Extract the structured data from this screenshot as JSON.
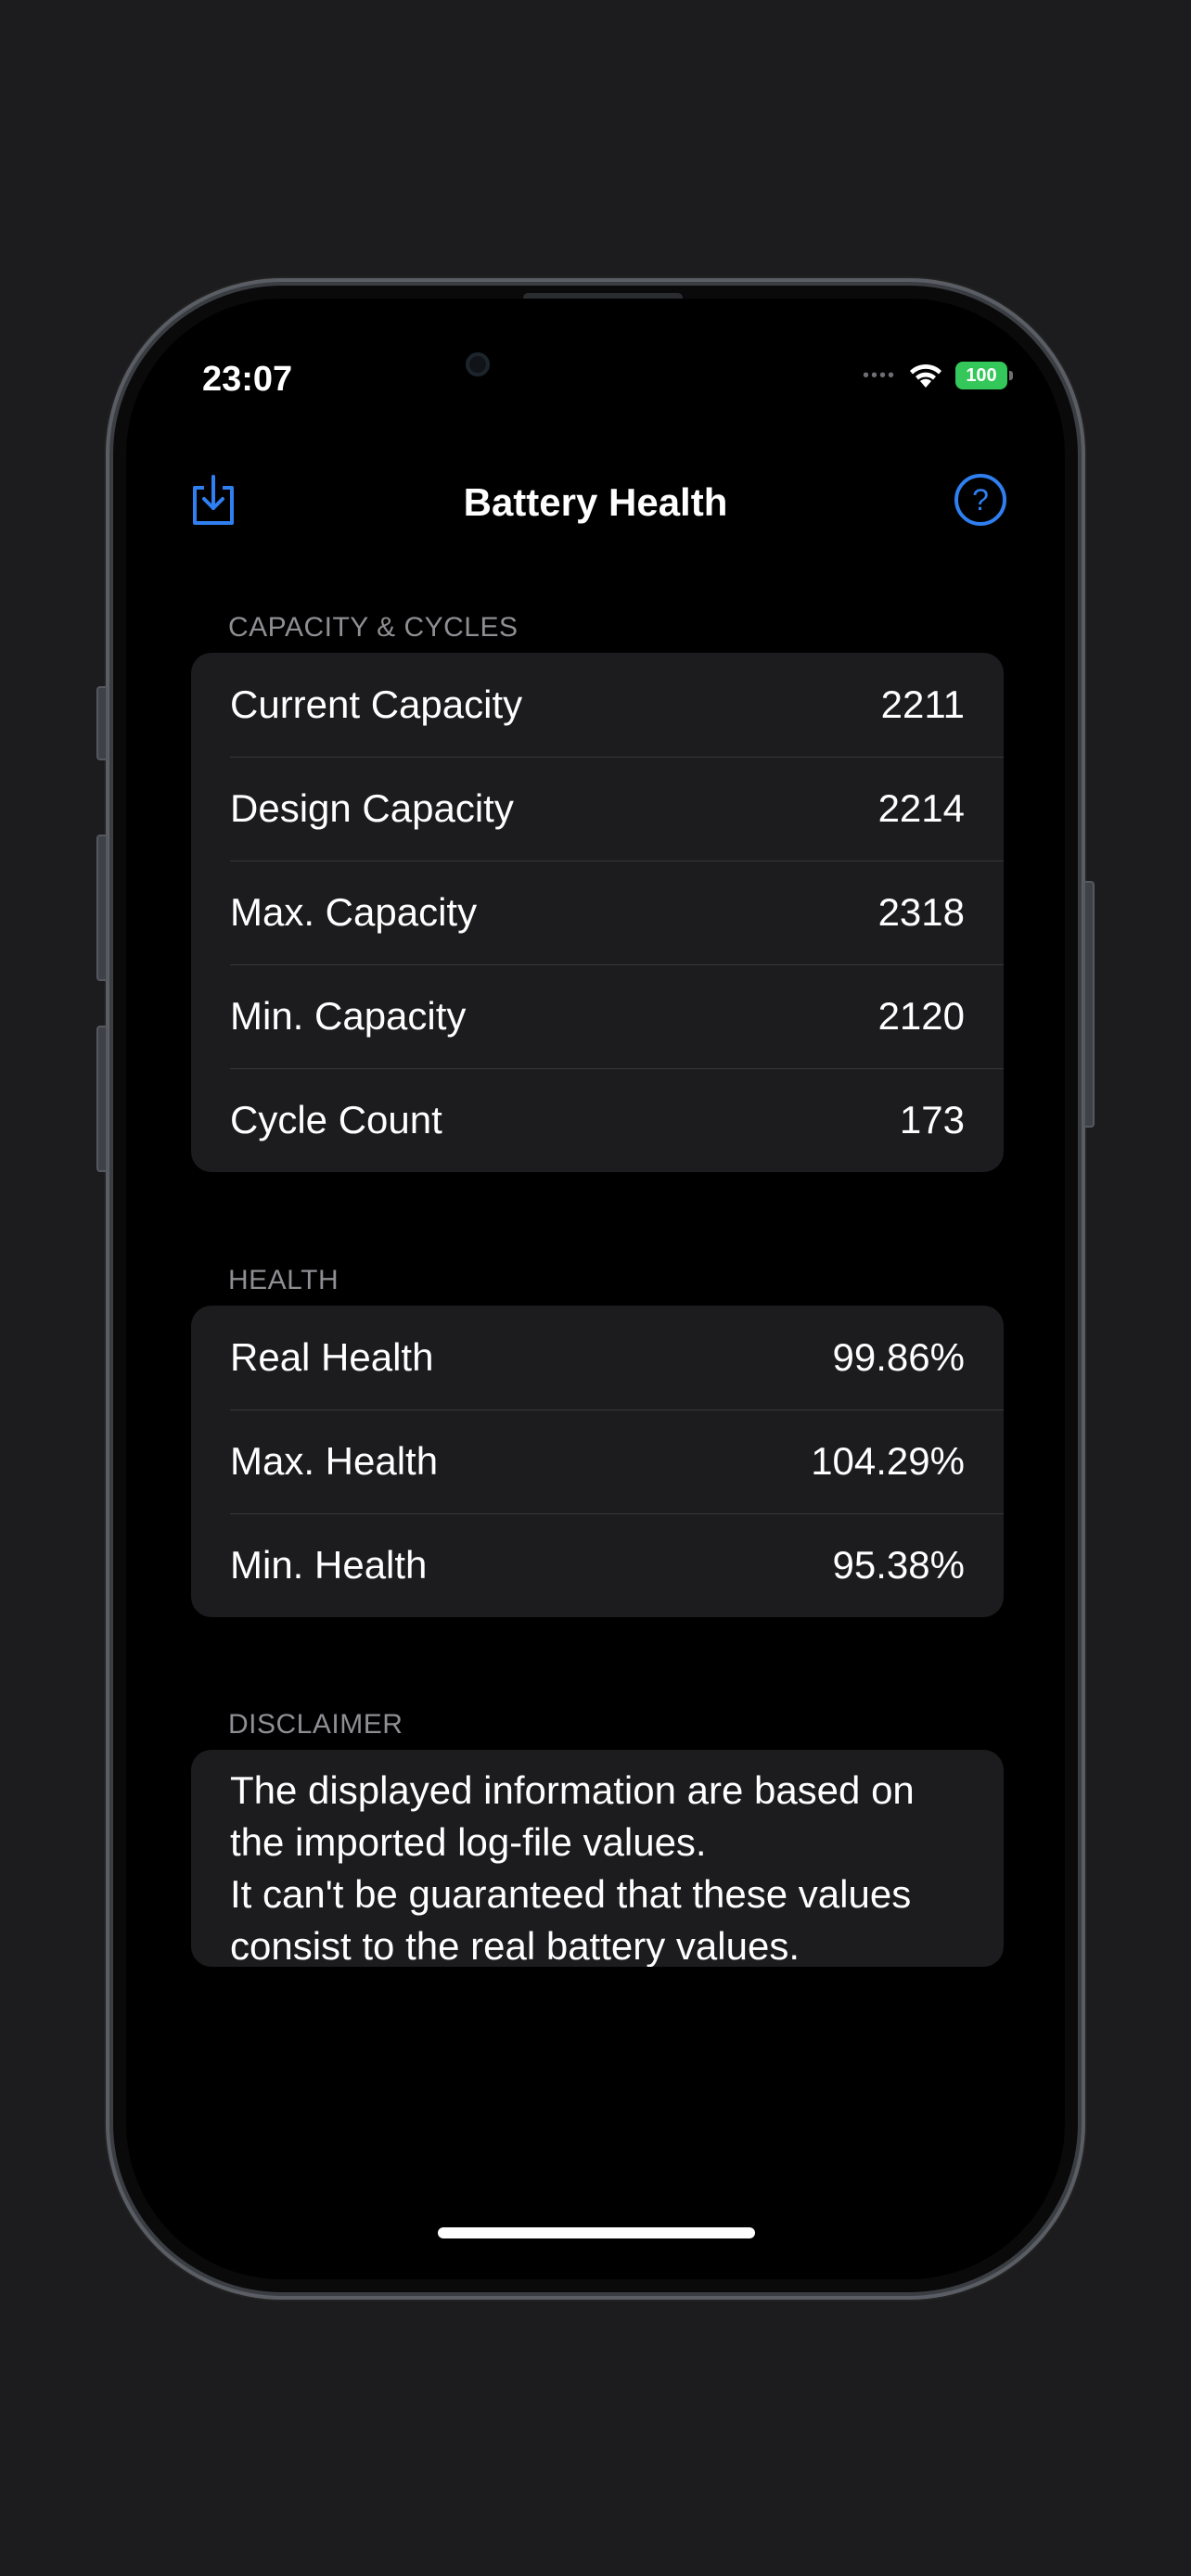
{
  "status_bar": {
    "time": "23:07",
    "battery_percent": "100"
  },
  "nav": {
    "title": "Battery Health",
    "left_icon": "import-icon",
    "right_icon": "help-icon"
  },
  "accent_color": "#2f7ff0",
  "sections": {
    "capacity": {
      "header": "CAPACITY & CYCLES",
      "rows": [
        {
          "label": "Current Capacity",
          "value": "2211"
        },
        {
          "label": "Design Capacity",
          "value": "2214"
        },
        {
          "label": "Max. Capacity",
          "value": "2318"
        },
        {
          "label": "Min. Capacity",
          "value": "2120"
        },
        {
          "label": "Cycle Count",
          "value": "173"
        }
      ]
    },
    "health": {
      "header": "HEALTH",
      "rows": [
        {
          "label": "Real Health",
          "value": "99.86%"
        },
        {
          "label": "Max. Health",
          "value": "104.29%"
        },
        {
          "label": "Min. Health",
          "value": "95.38%"
        }
      ]
    },
    "disclaimer": {
      "header": "DISCLAIMER",
      "line1": "The displayed information are based on the imported log-file values.",
      "line2": "It can't be guaranteed that these values consist to the real battery values."
    }
  }
}
